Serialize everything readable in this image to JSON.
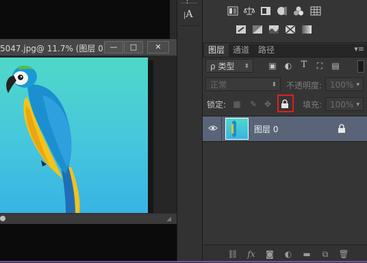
{
  "document": {
    "title": "5047.jpg@ 11.7% (图层 0, ...",
    "minimize_glyph": "—",
    "maximize_glyph": "□",
    "close_glyph": "✕"
  },
  "tool_strip": {
    "icons": [
      "paragraph-icon",
      "character-icon"
    ],
    "char_label": "A"
  },
  "adjustments": {
    "row1_icons": [
      "brightness-icon",
      "levels-icon",
      "curves-icon",
      "exposure-icon",
      "vibrance-icon",
      "channel-mixer-icon"
    ],
    "row2_icons": [
      "invert-icon",
      "posterize-icon",
      "threshold-icon",
      "selective-color-icon",
      "gradient-map-icon"
    ]
  },
  "layers_panel": {
    "tabs": [
      {
        "label": "图层",
        "active": true
      },
      {
        "label": "通道",
        "active": false
      },
      {
        "label": "路径",
        "active": false
      }
    ],
    "filter": {
      "prefix": "ρ",
      "value": "类型"
    },
    "filter_icons": {
      "text": "T"
    },
    "blend_mode": "正常",
    "opacity_label": "不透明度:",
    "opacity_value": "100%",
    "lock_label": "锁定:",
    "fill_label": "填充:",
    "fill_value": "100%",
    "layer": {
      "name": "图层 0",
      "visible": true,
      "locked": true
    },
    "highlight_color": "#e02020",
    "selected_row_color": "#596478"
  },
  "bottom_bar": {
    "icons": [
      "link-layers-icon",
      "fx-icon",
      "add-mask-icon",
      "adjustment-layer-icon",
      "new-group-icon",
      "new-layer-icon",
      "delete-layer-icon"
    ],
    "fx_label": "fx"
  }
}
